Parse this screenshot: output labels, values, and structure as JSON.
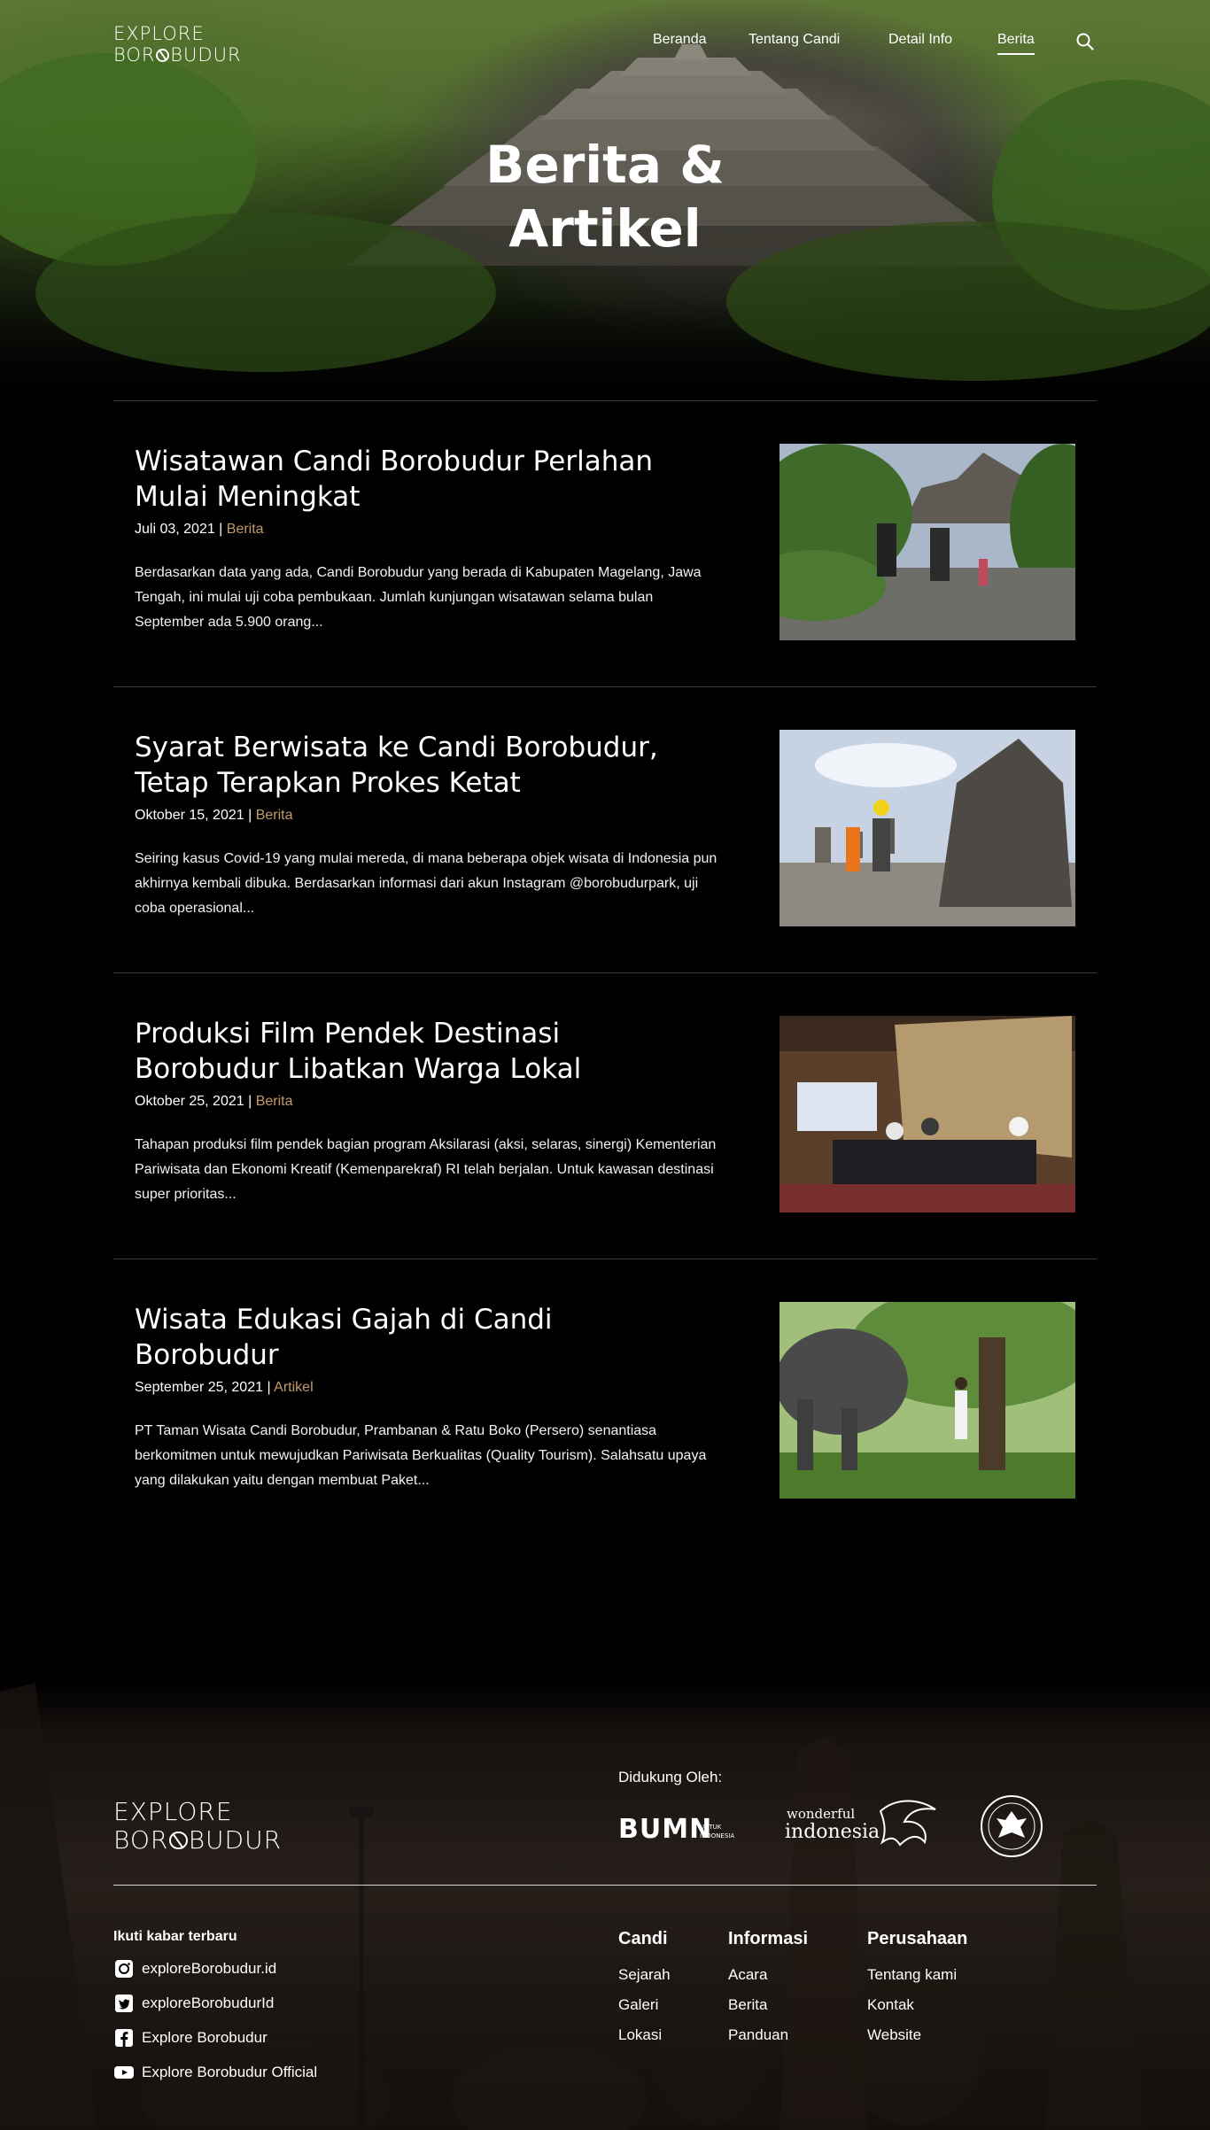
{
  "header": {
    "logo_line1": "EXPLORE",
    "logo_line2_pre": "BOR",
    "logo_line2_post": "BUDUR",
    "nav": [
      {
        "label": "Beranda"
      },
      {
        "label": "Tentang Candi"
      },
      {
        "label": "Detail Info"
      },
      {
        "label": "Berita",
        "active": true
      }
    ],
    "search_icon": "search-icon"
  },
  "hero": {
    "title_line1": "Berita &",
    "title_line2": "Artikel"
  },
  "articles": [
    {
      "title": "Wisatawan Candi Borobudur Perlahan Mulai Meningkat",
      "date": "Juli 03, 2021",
      "separator": " | ",
      "category": "Berita",
      "excerpt": "Berdasarkan data yang ada, Candi Borobudur yang berada di Kabupaten Magelang, Jawa Tengah, ini mulai uji coba pembukaan. Jumlah kunjungan wisatawan selama bulan September ada 5.900 orang..."
    },
    {
      "title": "Syarat Berwisata ke Candi Borobudur, Tetap Terapkan Prokes Ketat",
      "date": "Oktober 15, 2021",
      "separator": " | ",
      "category": "Berita",
      "excerpt": "Seiring kasus Covid-19 yang mulai mereda, di mana beberapa objek wisata di Indonesia pun akhirnya kembali dibuka. Berdasarkan informasi dari akun Instagram @borobudurpark, uji coba operasional..."
    },
    {
      "title": "Produksi Film Pendek Destinasi Borobudur Libatkan Warga Lokal",
      "date": "Oktober 25, 2021",
      "separator": " | ",
      "category": "Berita",
      "excerpt": "Tahapan produksi film pendek bagian program Aksilarasi (aksi, selaras, sinergi) Kementerian Pariwisata dan Ekonomi Kreatif (Kemenparekraf) RI telah berjalan. Untuk kawasan destinasi super prioritas..."
    },
    {
      "title": "Wisata Edukasi Gajah di Candi Borobudur",
      "date": "September 25, 2021",
      "separator": " | ",
      "category": "Artikel",
      "excerpt": "PT Taman Wisata Candi Borobudur, Prambanan & Ratu Boko (Persero) senantiasa berkomitmen untuk mewujudkan Pariwisata Berkualitas (Quality Tourism). Salahsatu upaya yang dilakukan yaitu dengan membuat Paket..."
    }
  ],
  "footer": {
    "logo_line1": "EXPLORE",
    "logo_line2_pre": "BOR",
    "logo_line2_post": "BUDUR",
    "supported_by": "Didukung Oleh:",
    "sponsors": {
      "bumn": "BUMN",
      "bumn_sub1": "UNTUK",
      "bumn_sub2": "INDONESIA",
      "wi_line1": "wonderful",
      "wi_line2": "indonesia"
    },
    "follow_title": "Ikuti kabar terbaru",
    "socials": [
      {
        "icon": "instagram-icon",
        "label": "exploreBorobudur.id"
      },
      {
        "icon": "twitter-icon",
        "label": "exploreBorobudurId"
      },
      {
        "icon": "facebook-icon",
        "label": "Explore Borobudur"
      },
      {
        "icon": "youtube-icon",
        "label": "Explore Borobudur Official"
      }
    ],
    "columns": [
      {
        "heading": "Candi",
        "links": [
          "Sejarah",
          "Galeri",
          "Lokasi"
        ]
      },
      {
        "heading": "Informasi",
        "links": [
          "Acara",
          "Berita",
          "Panduan"
        ]
      },
      {
        "heading": "Perusahaan",
        "links": [
          "Tentang kami",
          "Kontak",
          "Website"
        ]
      }
    ]
  }
}
